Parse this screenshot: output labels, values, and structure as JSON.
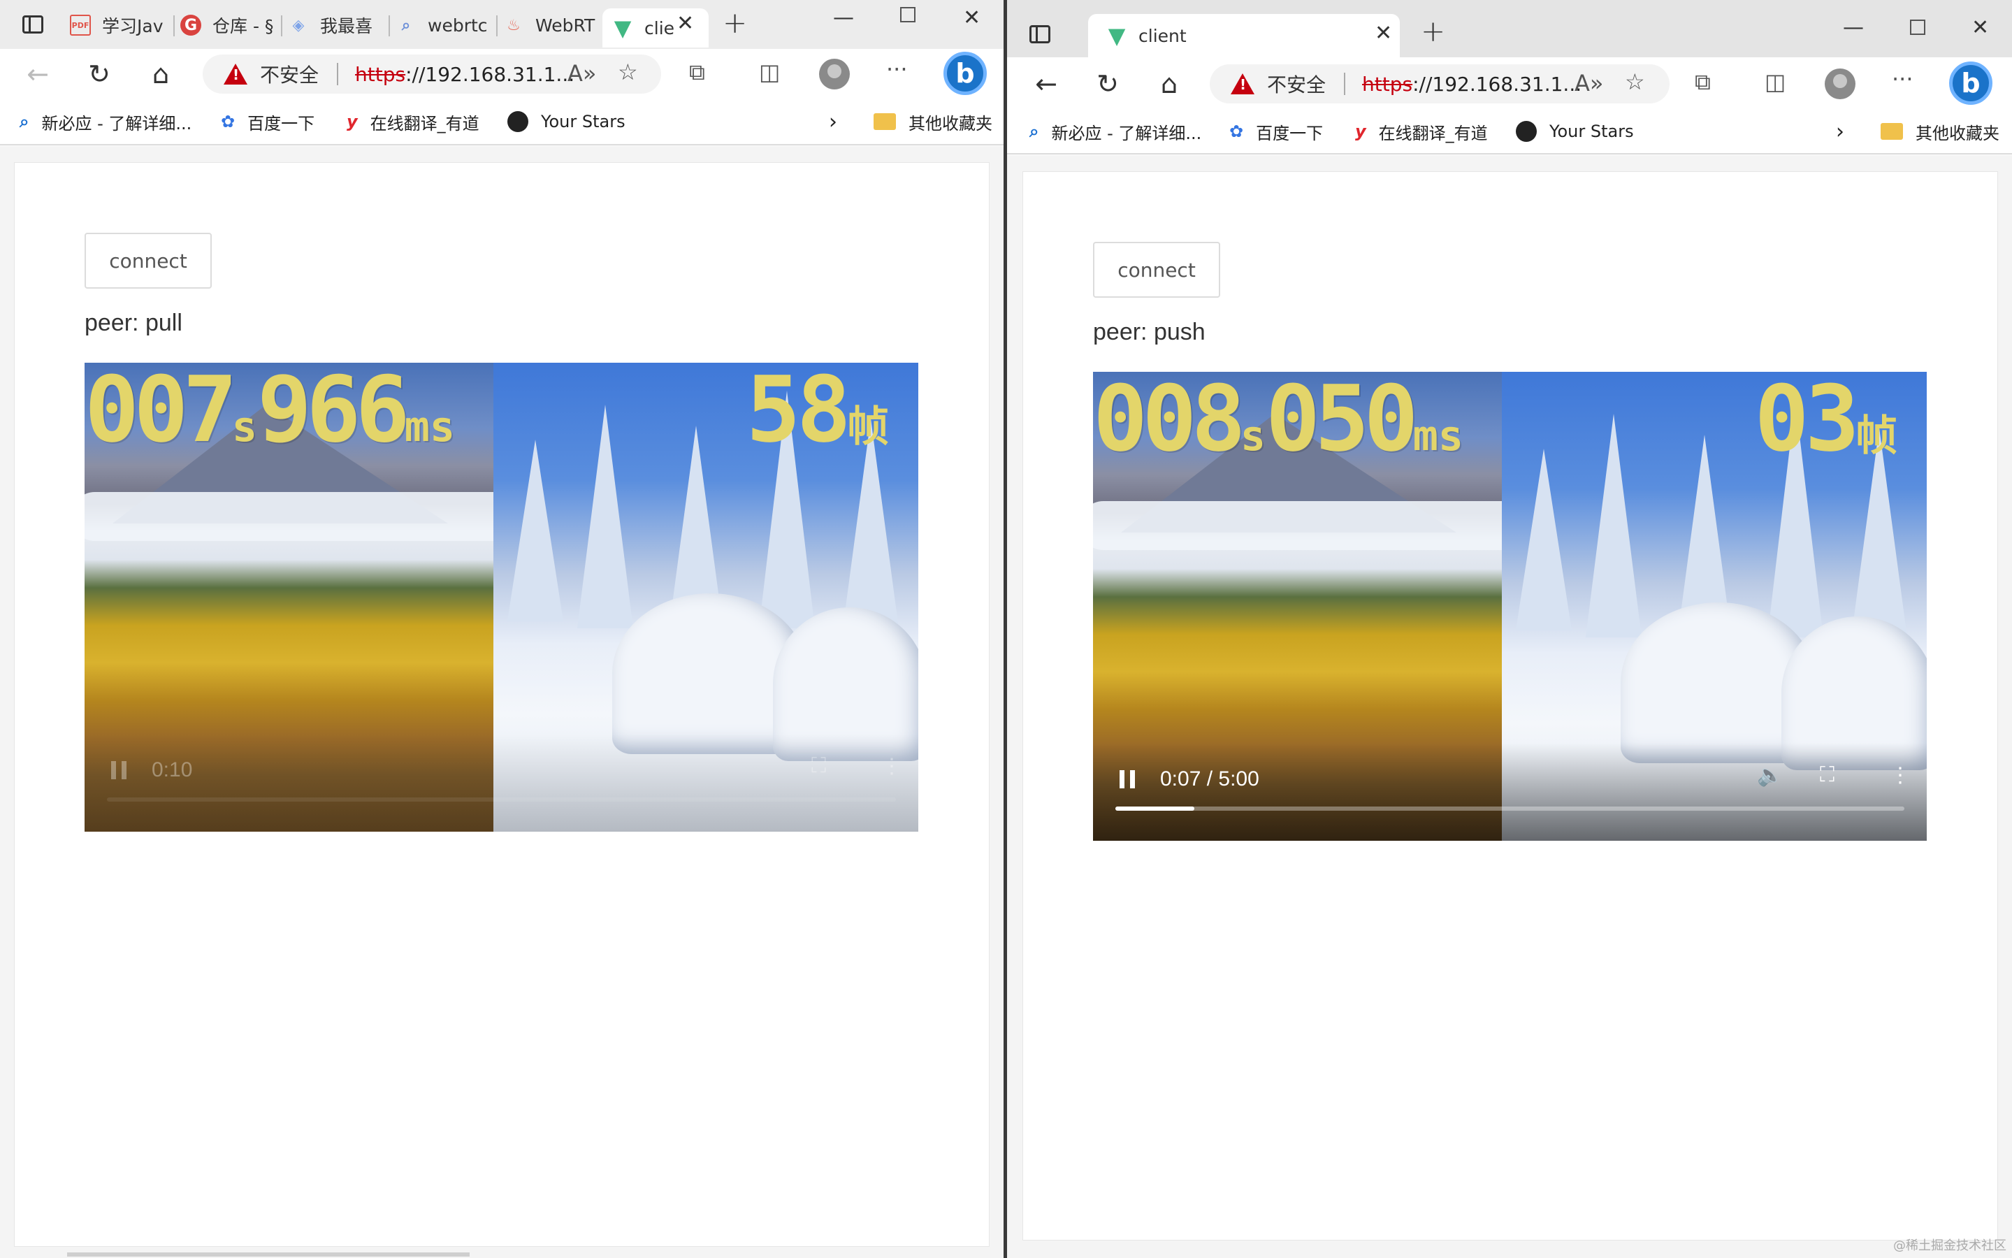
{
  "left_window": {
    "tabs": [
      {
        "label": "学习Jav",
        "icon": "pdf-icon"
      },
      {
        "label": "仓库 - §",
        "icon": "gitee-icon"
      },
      {
        "label": "我最喜",
        "icon": "layers-icon"
      },
      {
        "label": "webrtc",
        "icon": "search-icon"
      },
      {
        "label": "WebRT",
        "icon": "flame-icon"
      },
      {
        "label": "clie",
        "icon": "vue-icon"
      }
    ],
    "address": {
      "warning": "不安全",
      "scheme": "https",
      "rest": "://192.168.31.1..."
    },
    "connect_label": "connect",
    "peer_label": "peer: pull",
    "video": {
      "time_digits": "007",
      "time_unit_s": "s",
      "ms_digits": "966",
      "ms_unit": "ms",
      "frame_digits": "58",
      "frame_unit": "帧",
      "position": "0:10"
    }
  },
  "right_window": {
    "tab": {
      "label": "client",
      "icon": "vue-icon"
    },
    "address": {
      "warning": "不安全",
      "scheme": "https",
      "rest": "://192.168.31.1..."
    },
    "connect_label": "connect",
    "peer_label": "peer: push",
    "video": {
      "time_digits": "008",
      "time_unit_s": "s",
      "ms_digits": "050",
      "ms_unit": "ms",
      "frame_digits": "03",
      "frame_unit": "帧",
      "position": "0:07 / 5:00",
      "progress_fraction": 0.1
    }
  },
  "favorites": [
    {
      "label": "新必应 - 了解详细...",
      "icon": "search-icon"
    },
    {
      "label": "百度一下",
      "icon": "paw-icon"
    },
    {
      "label": "在线翻译_有道",
      "icon": "youdao-icon"
    },
    {
      "label": "Your Stars",
      "icon": "github-icon"
    }
  ],
  "other_favorites": "其他收藏夹",
  "watermark": "@稀土掘金技术社区",
  "colors": {
    "osd_yellow": "#e3d56a",
    "warning_red": "#c5000f",
    "bing_blue": "#1a73c9"
  }
}
